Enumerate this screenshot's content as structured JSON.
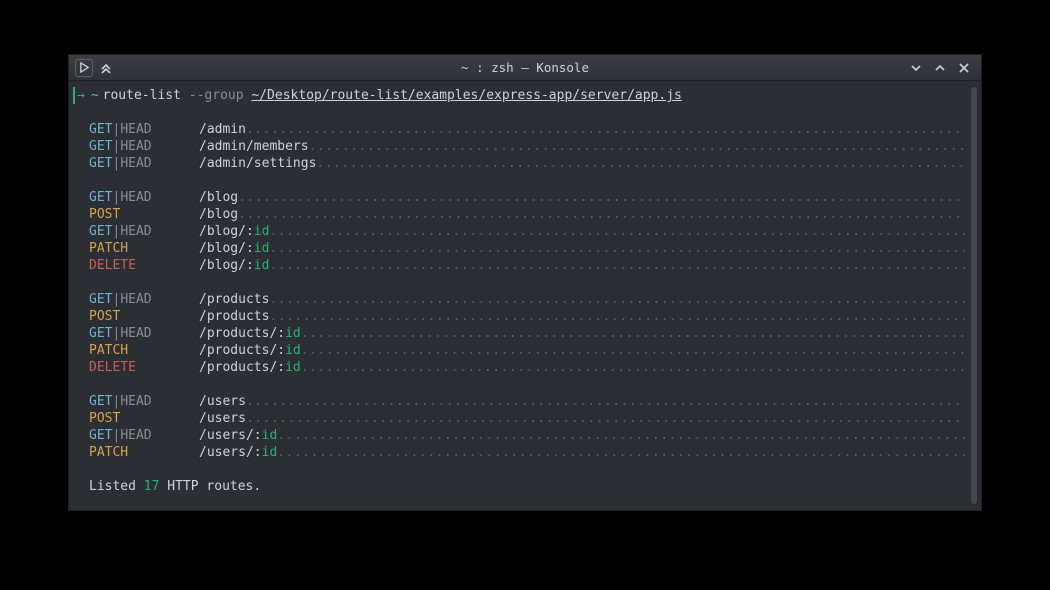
{
  "window": {
    "title": "~ : zsh — Konsole"
  },
  "prompt": {
    "arrow": "→",
    "cwd": "~",
    "command": "route-list",
    "flag": "--group",
    "path": "~/Desktop/route-list/examples/express-app/server/app.js"
  },
  "route_groups": [
    {
      "routes": [
        {
          "method": "GET|HEAD",
          "path": "/admin"
        },
        {
          "method": "GET|HEAD",
          "path": "/admin/members"
        },
        {
          "method": "GET|HEAD",
          "path": "/admin/settings"
        }
      ]
    },
    {
      "routes": [
        {
          "method": "GET|HEAD",
          "path": "/blog"
        },
        {
          "method": "POST",
          "path": "/blog"
        },
        {
          "method": "GET|HEAD",
          "path": "/blog/:",
          "param": "id"
        },
        {
          "method": "PATCH",
          "path": "/blog/:",
          "param": "id"
        },
        {
          "method": "DELETE",
          "path": "/blog/:",
          "param": "id"
        }
      ]
    },
    {
      "routes": [
        {
          "method": "GET|HEAD",
          "path": "/products"
        },
        {
          "method": "POST",
          "path": "/products"
        },
        {
          "method": "GET|HEAD",
          "path": "/products/:",
          "param": "id"
        },
        {
          "method": "PATCH",
          "path": "/products/:",
          "param": "id"
        },
        {
          "method": "DELETE",
          "path": "/products/:",
          "param": "id"
        }
      ]
    },
    {
      "routes": [
        {
          "method": "GET|HEAD",
          "path": "/users"
        },
        {
          "method": "POST",
          "path": "/users"
        },
        {
          "method": "GET|HEAD",
          "path": "/users/:",
          "param": "id"
        },
        {
          "method": "PATCH",
          "path": "/users/:",
          "param": "id"
        }
      ]
    }
  ],
  "summary": {
    "prefix": "Listed ",
    "count": "17",
    "suffix": " HTTP routes."
  },
  "colors": {
    "bg": "#2b2e33",
    "fg": "#cfd2d6",
    "muted": "#8a8d92",
    "get": "#6fb3d2",
    "post": "#d6a24b",
    "patch": "#d6a24b",
    "delete": "#c75f5f",
    "accent": "#2fae79",
    "dots": "#585b60"
  }
}
